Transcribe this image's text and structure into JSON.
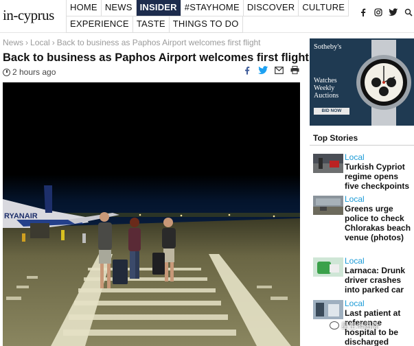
{
  "site": {
    "logo": "in-cyprus"
  },
  "nav": {
    "row1": [
      "HOME",
      "NEWS",
      "INSIDER",
      "#STAYHOME",
      "DISCOVER",
      "CULTURE"
    ],
    "row2": [
      "EXPERIENCE",
      "TASTE",
      "THINGS TO DO"
    ],
    "active": "INSIDER"
  },
  "social_icons": [
    "facebook-icon",
    "instagram-icon",
    "twitter-icon",
    "search-icon"
  ],
  "breadcrumb": {
    "items": [
      "News",
      "Local",
      "Back to business as Paphos Airport welcomes first flight"
    ]
  },
  "article": {
    "title": "Back to business as Paphos Airport welcomes first flight",
    "time": "2 hours ago",
    "share_icons": [
      "facebook-icon",
      "twitter-icon",
      "email-icon",
      "print-icon"
    ],
    "photo_text": "RYANAIR"
  },
  "ad": {
    "brand": "Sotheby's ",
    "line1": "Watches",
    "line2": "Weekly",
    "line3": "Auctions",
    "button": "BID NOW",
    "bg": "#1f3a52"
  },
  "top_stories": {
    "heading": "Top Stories",
    "items": [
      {
        "category": "Local",
        "title": "Turkish Cypriot regime opens five checkpoints"
      },
      {
        "category": "Local",
        "title": "Greens urge police to check Chlorakas beach venue (photos)"
      },
      {
        "category": "Local",
        "title": "Larnaca: Drunk driver crashes into parked car"
      },
      {
        "category": "Local",
        "title": "Last patient at reference hospital to be discharged"
      }
    ]
  },
  "watermark": "星空海国际",
  "colors": {
    "nav_active_bg": "#1d2c4d",
    "link_blue": "#1a9ad6",
    "twitter_blue": "#1da1f2",
    "facebook_blue": "#3b5998"
  }
}
